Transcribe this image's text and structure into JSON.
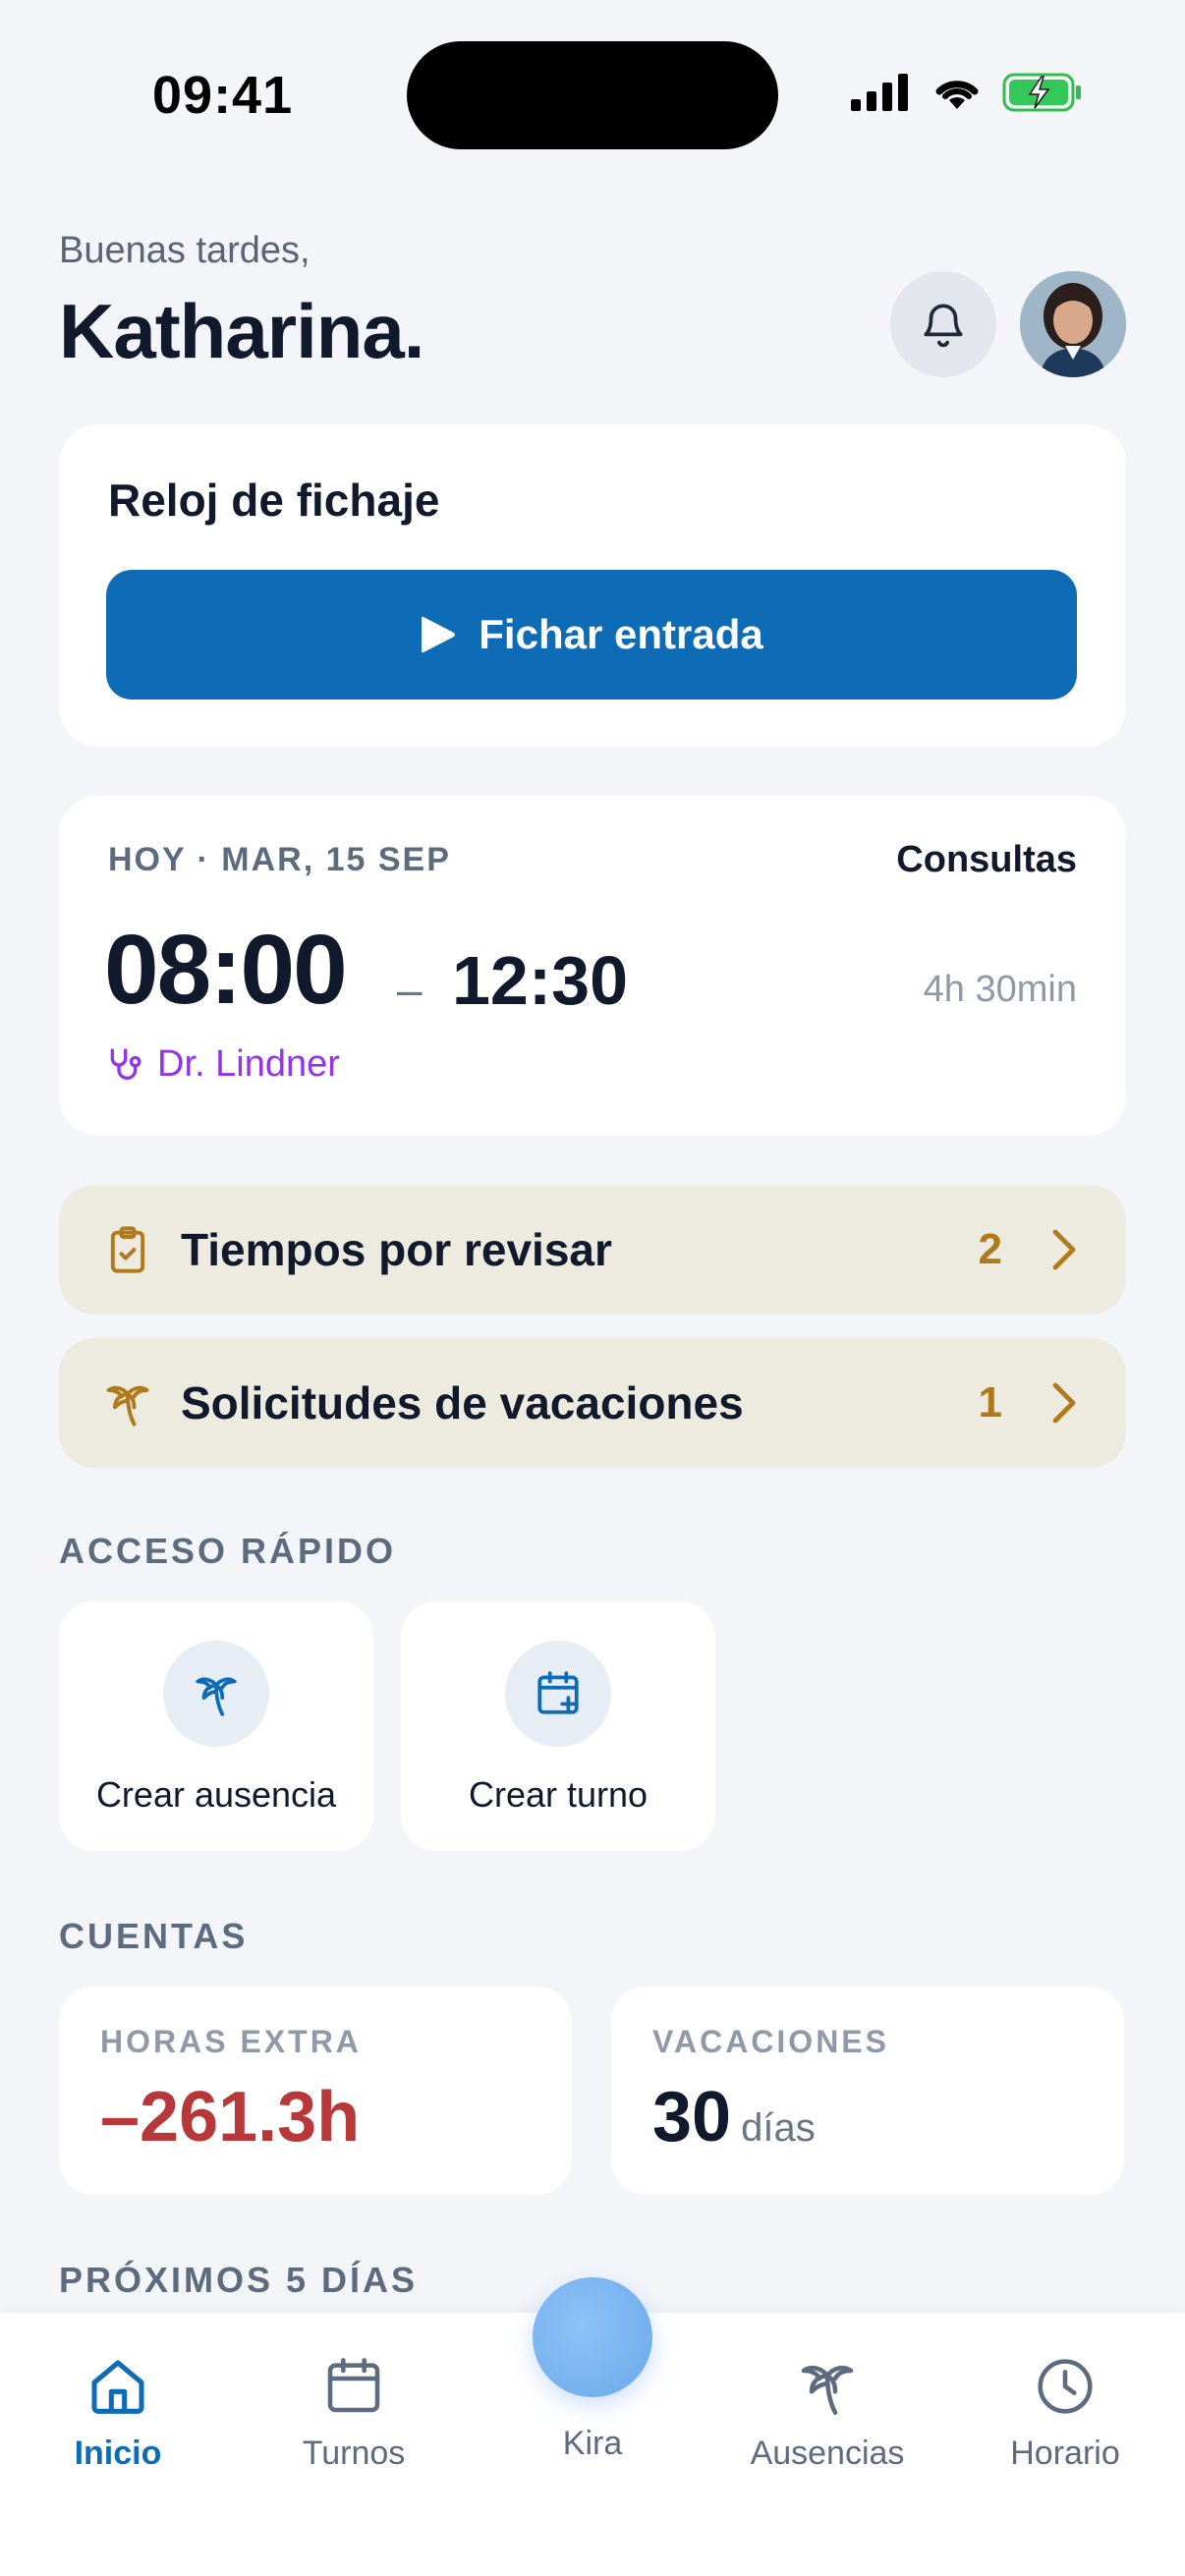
{
  "status_bar": {
    "time": "09:41"
  },
  "header": {
    "greeting": "Buenas tardes,",
    "name": "Katharina."
  },
  "clock_card": {
    "title": "Reloj de fichaje",
    "button_label": "Fichar entrada"
  },
  "shift_card": {
    "date": "HOY · MAR, 15 SEP",
    "type": "Consultas",
    "start": "08:00",
    "dash": "–",
    "end": "12:30",
    "duration": "4h 30min",
    "doctor": "Dr. Lindner"
  },
  "pending": [
    {
      "label": "Tiempos por revisar",
      "count": "2",
      "icon": "clipboard-check-icon"
    },
    {
      "label": "Solicitudes de vacaciones",
      "count": "1",
      "icon": "palm-tree-icon"
    }
  ],
  "quick_access": {
    "title": "ACCESO RÁPIDO",
    "items": [
      {
        "label": "Crear ausencia",
        "icon": "palm-tree-icon"
      },
      {
        "label": "Crear turno",
        "icon": "calendar-plus-icon"
      }
    ]
  },
  "accounts": {
    "title": "CUENTAS",
    "overtime": {
      "label": "HORAS EXTRA",
      "value": "–261.3h"
    },
    "vacation": {
      "label": "VACACIONES",
      "value": "30",
      "unit": "días"
    }
  },
  "upcoming": {
    "title": "PRÓXIMOS 5 DÍAS"
  },
  "nav": {
    "items": [
      {
        "label": "Inicio",
        "icon": "home-icon",
        "active": true
      },
      {
        "label": "Turnos",
        "icon": "calendar-icon"
      },
      {
        "label": "Kira",
        "icon": "assistant-orb"
      },
      {
        "label": "Ausencias",
        "icon": "palm-tree-icon"
      },
      {
        "label": "Horario",
        "icon": "clock-icon"
      }
    ]
  },
  "colors": {
    "primary": "#0e6bb5",
    "negative": "#b8383a",
    "doctor": "#9333ea",
    "warning_count": "#b0791a",
    "pending_bg": "#edeae0",
    "background": "#f3f5f9"
  }
}
